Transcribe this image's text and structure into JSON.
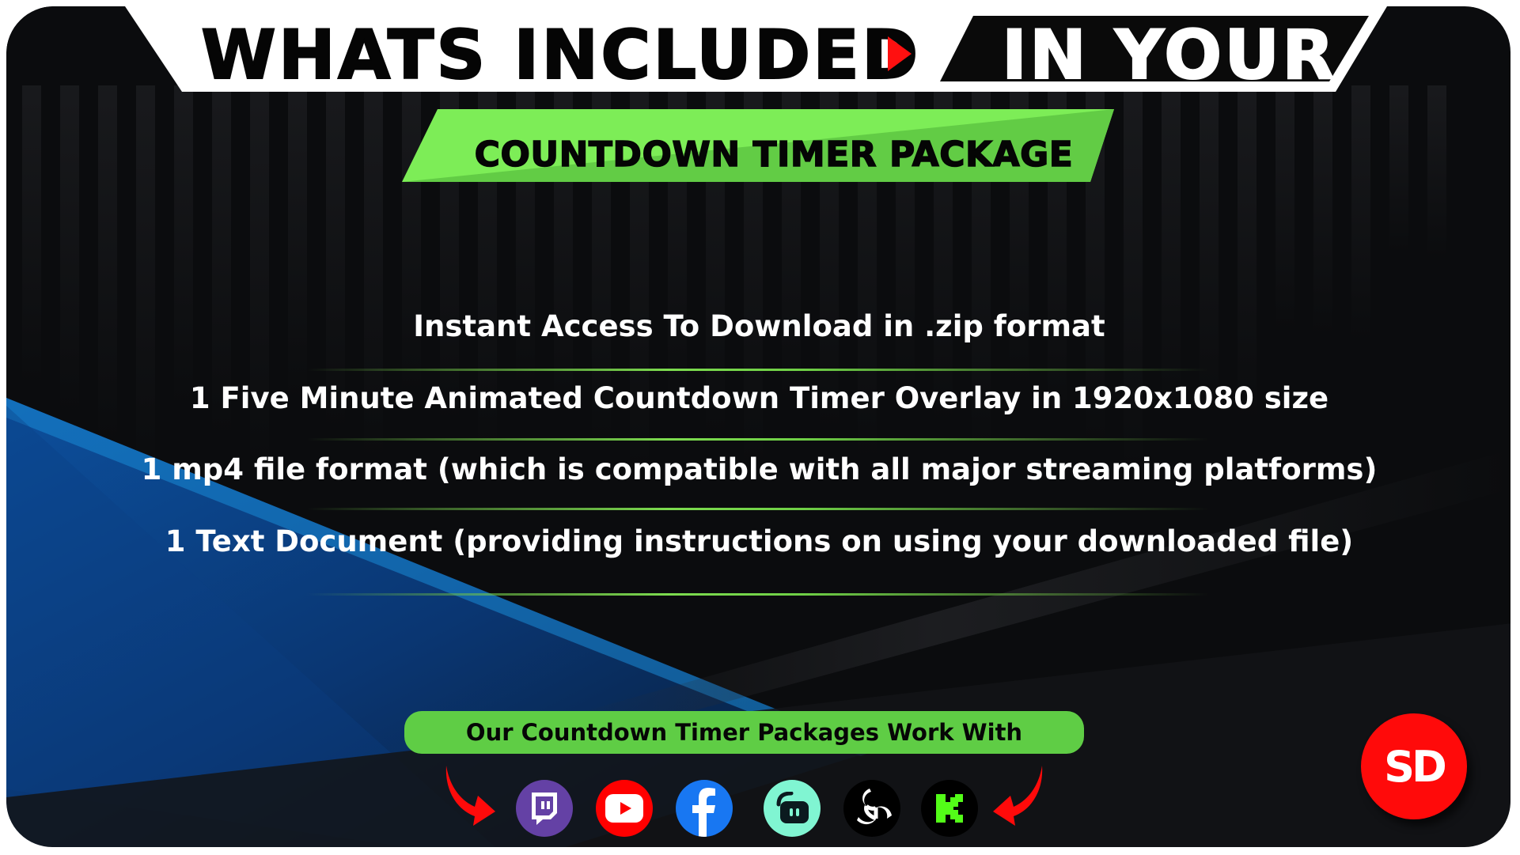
{
  "header": {
    "title_left": "WHATS INCLUDED",
    "title_right": "IN YOUR",
    "play_icon": "play-triangle-icon"
  },
  "banner": {
    "subtitle": "COUNTDOWN TIMER PACKAGE"
  },
  "features": [
    {
      "text": "Instant Access To Download in .zip format"
    },
    {
      "text": "1 Five Minute Animated Countdown Timer Overlay in 1920x1080 size"
    },
    {
      "text": "1 mp4 file format (which is compatible with all major streaming platforms)"
    },
    {
      "text": "1 Text Document (providing instructions on using your downloaded file)"
    }
  ],
  "compat": {
    "label": "Our Countdown Timer Packages Work With",
    "platforms": [
      {
        "name": "Twitch",
        "icon": "twitch-icon",
        "color": "#6441a5"
      },
      {
        "name": "YouTube",
        "icon": "youtube-icon",
        "color": "#ff0000"
      },
      {
        "name": "Facebook",
        "icon": "facebook-icon",
        "color": "#1877f2"
      },
      {
        "name": "Streamlabs",
        "icon": "streamlabs-icon",
        "color": "#80f5d2"
      },
      {
        "name": "OBS",
        "icon": "obs-icon",
        "color": "#000000"
      },
      {
        "name": "Kick",
        "icon": "kick-icon",
        "color": "#000000"
      }
    ]
  },
  "brand": {
    "logo_text": "SD",
    "logo_color": "#ff0a0a"
  },
  "colors": {
    "accent_green": "#7ddc4f",
    "pill_green": "#5fcd45",
    "arrow_red": "#ff0a0a",
    "background": "#0b0c0e"
  }
}
